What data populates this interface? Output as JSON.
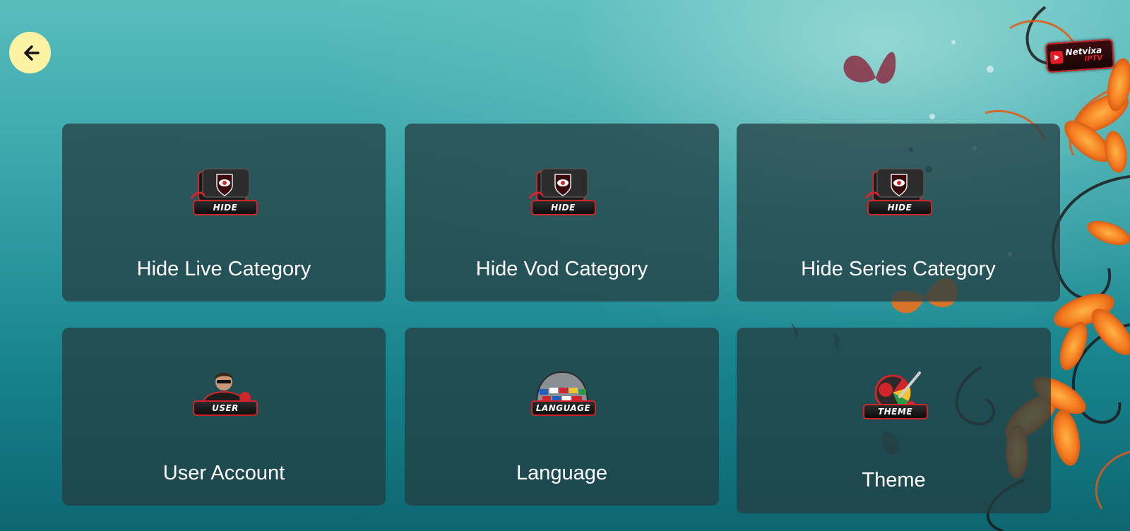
{
  "header": {
    "back_icon": "arrow-left-icon",
    "brand": {
      "name": "Netvixa",
      "sub": "IPTV",
      "color": "#e31d25"
    }
  },
  "colors": {
    "back_button_bg": "#fbf3a3",
    "card_bg": "#233e42",
    "accent_red": "#d0262b"
  },
  "menu": {
    "items": [
      {
        "label": "Hide Live Category",
        "icon": "hide-eye-icon",
        "badge": "HIDE"
      },
      {
        "label": "Hide Vod Category",
        "icon": "hide-eye-icon",
        "badge": "HIDE"
      },
      {
        "label": "Hide Series Category",
        "icon": "hide-eye-icon",
        "badge": "HIDE"
      },
      {
        "label": "User Account",
        "icon": "user-icon",
        "badge": "USER"
      },
      {
        "label": "Language",
        "icon": "language-globe-icon",
        "badge": "LANGUAGE"
      },
      {
        "label": "Theme",
        "icon": "theme-palette-icon",
        "badge": "THEME"
      }
    ]
  }
}
